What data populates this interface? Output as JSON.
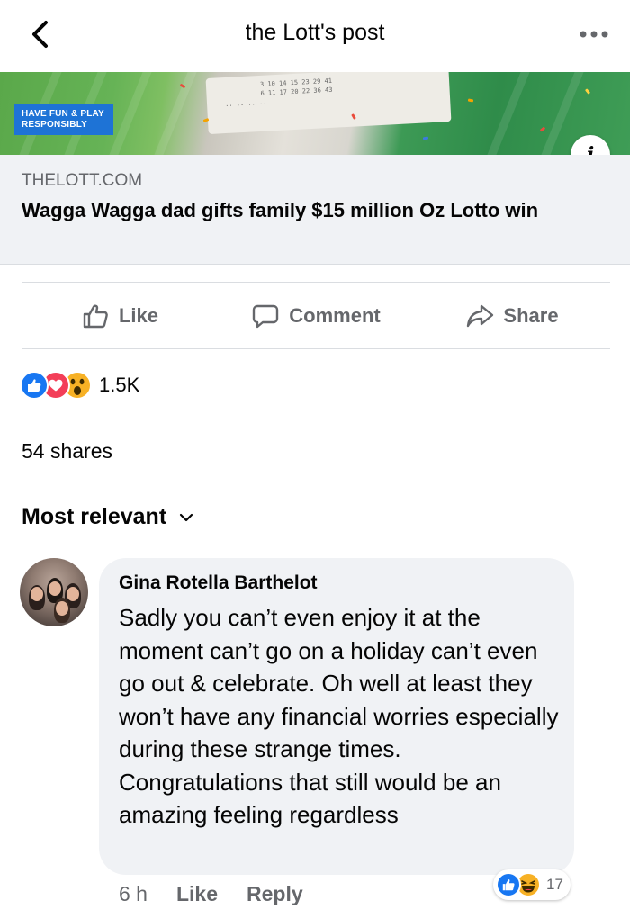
{
  "header": {
    "title": "the Lott's post"
  },
  "preview": {
    "badge_line1": "HAVE FUN & PLAY",
    "badge_line2": "RESPONSIBLY",
    "domain": "THELOTT.COM",
    "headline": "Wagga Wagga dad gifts family $15 million Oz Lotto win"
  },
  "actions": {
    "like": "Like",
    "comment": "Comment",
    "share": "Share"
  },
  "reactions": {
    "icons": [
      "like-icon",
      "love-icon",
      "wow-icon"
    ],
    "count": "1.5K"
  },
  "shares": "54 shares",
  "sort": {
    "label": "Most relevant"
  },
  "comment": {
    "author": "Gina Rotella Barthelot",
    "text": "Sadly you can’t even enjoy it at the moment can’t go on a holiday can’t even go out & celebrate.  Oh well at least they won’t have any financial worries especially during these strange times.  Congratulations that still would be an amazing feeling regardless",
    "time": "6 h",
    "like_label": "Like",
    "reply_label": "Reply",
    "reaction_icons": [
      "like-icon",
      "haha-icon"
    ],
    "reaction_count": "17"
  },
  "colors": {
    "facebook_blue": "#1877f2",
    "love_red": "#f33e58",
    "emoji_yellow": "#f7b125",
    "badge_blue": "#1e73d6",
    "secondary_text": "#65676b",
    "bubble_bg": "#f0f2f5"
  }
}
